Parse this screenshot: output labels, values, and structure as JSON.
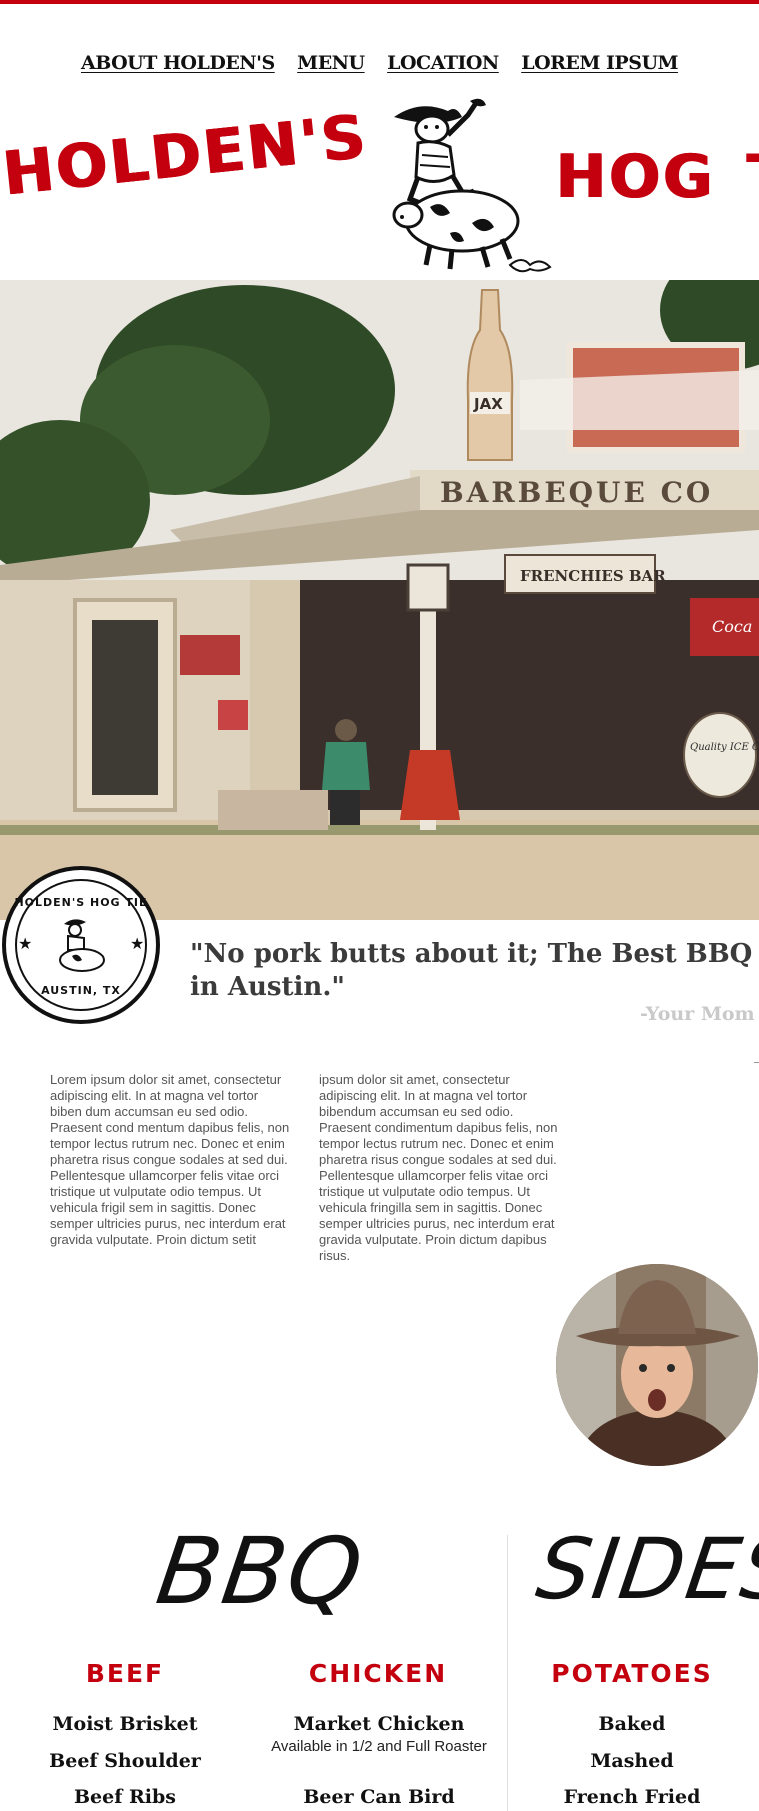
{
  "nav": {
    "items": [
      {
        "label": "ABOUT HOLDEN'S"
      },
      {
        "label": "MENU"
      },
      {
        "label": "LOCATION"
      },
      {
        "label": "LOREM IPSUM"
      }
    ]
  },
  "brand": {
    "left_word": "HOLDEN'S",
    "right_word": "HOG",
    "right_cut": "T"
  },
  "hero": {
    "signs": {
      "bottle": "JAX",
      "store": "BARBEQUE CO",
      "frenchies": "FRENCHIES BAR",
      "quality": "Quality ICE CREAM",
      "cola": "Coca"
    }
  },
  "badge": {
    "top_text": "HOLDEN'S HOG TIE",
    "bottom_text": "AUSTIN, TX"
  },
  "testimonial": {
    "quote": "\"No pork butts about it; The Best BBQ in Austin.\"",
    "attribution": "-Your Mom"
  },
  "about": {
    "column1": "Lorem ipsum dolor sit amet, consectetur adipiscing elit. In at magna vel tortor biben dum accumsan eu sed odio. Praesent cond mentum dapibus felis, non tempor lectus rutrum nec. Donec et enim pharetra risus congue sodales at sed dui. Pellentesque ullamcorper felis vitae orci tristique ut vulputate odio tempus. Ut vehicula frigil sem in sagittis. Donec semper ultricies purus, nec interdum erat gravida vulputate. Proin dictum setit",
    "column2": "ipsum dolor sit amet, consectetur adipiscing elit. In at magna vel tortor bibendum accumsan eu sed odio. Praesent condimentum dapibus felis, non tempor lectus rutrum nec. Donec et enim pharetra risus congue sodales at sed dui. Pellentesque ullamcorper felis vitae orci tristique ut vulputate odio tempus. Ut vehicula fringilla sem in sagittis. Donec semper ultricies purus, nec interdum erat gravida vulputate. Proin dictum dapibus risus."
  },
  "menu": {
    "bbq_heading": "BBQ",
    "sides_heading": "SIDES",
    "categories": [
      {
        "title": "BEEF",
        "items": [
          "Moist Brisket",
          "Beef Shoulder",
          "Beef Ribs"
        ]
      },
      {
        "title": "CHICKEN",
        "items": [
          "Market Chicken",
          "Beer Can Bird"
        ],
        "note": "Available in 1/2 and Full Roaster"
      },
      {
        "title": "POTATOES",
        "items": [
          "Baked",
          "Mashed",
          "French Fried"
        ]
      }
    ]
  },
  "colors": {
    "accent_red": "#c4000f",
    "text_dark": "#111111",
    "attribution_gray": "#c9c9c9"
  }
}
